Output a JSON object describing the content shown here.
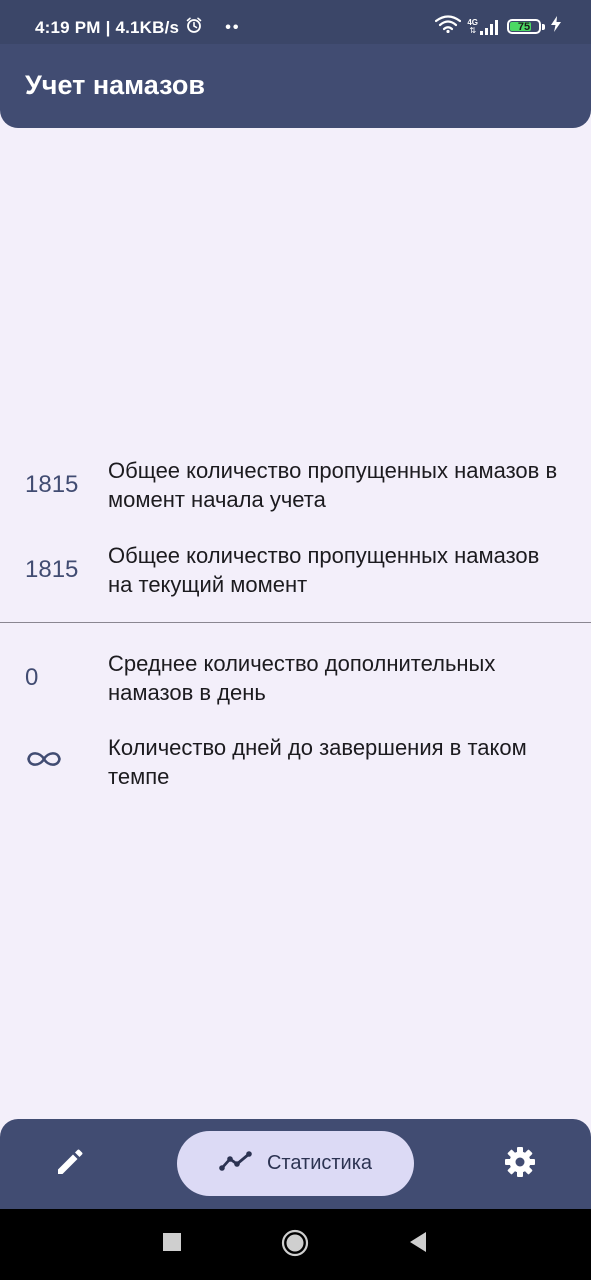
{
  "status_bar": {
    "time_speed": "4:19 PM | 4.1KB/s",
    "dots": "••",
    "network": "4G",
    "battery_level": "75",
    "battery_fraction": 0.75
  },
  "app_bar": {
    "title": "Учет намазов"
  },
  "stats": [
    {
      "value": "1815",
      "label": "Общее количество пропущенных намазов в момент начала учета"
    },
    {
      "value": "1815",
      "label": "Общее количество пропущенных намазов на текущий момент"
    },
    {
      "value": "0",
      "label": "Среднее количество дополнительных намазов в день"
    },
    {
      "value_icon": "infinity-icon",
      "label": "Количество дней до завершения в таком темпе"
    }
  ],
  "bottom_nav": {
    "items": [
      {
        "icon": "pencil-icon",
        "label": ""
      },
      {
        "icon": "trending-line-icon",
        "label": "Статистика",
        "selected": true
      },
      {
        "icon": "gear-icon",
        "label": ""
      }
    ]
  },
  "system_nav": {
    "icons": [
      "square-recents-icon",
      "circle-home-icon",
      "triangle-back-icon"
    ]
  },
  "colors": {
    "primary": "#414c72",
    "background": "#f3effa",
    "selected_pill": "#dcdaf5",
    "battery": "#4cd964"
  }
}
